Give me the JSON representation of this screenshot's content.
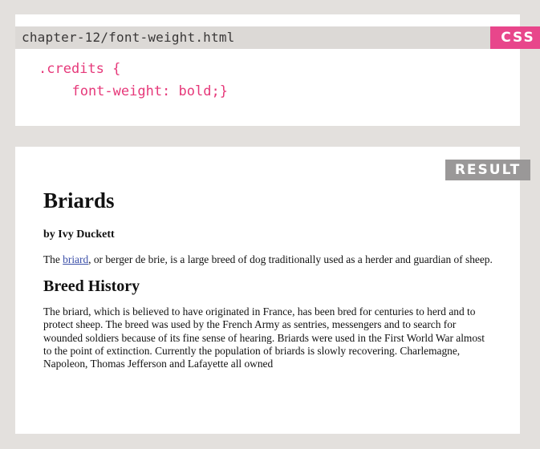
{
  "code_panel": {
    "file_name": "chapter-12/font-weight.html",
    "badge": "CSS",
    "lines": [
      ".credits {",
      "  font-weight: bold;}"
    ]
  },
  "result_panel": {
    "badge": "RESULT",
    "heading": "Briards",
    "credits": "by Ivy Duckett",
    "intro_before_link": "The ",
    "intro_link": "briard",
    "intro_after_link": ", or berger de brie, is a large breed of dog traditionally used as a herder and guardian of sheep.",
    "subheading": "Breed History",
    "history_text": "The briard, which is believed to have originated in France, has been bred for centuries to herd and to protect sheep. The breed was used by the French Army as sentries, messengers and to search for wounded soldiers because of its fine sense of hearing. Briards were used in the First World War almost to the point of extinction. Currently the population of briards is slowly recovering. Charlemagne, Napoleon, Thomas Jefferson and Lafayette all owned"
  },
  "colors": {
    "background": "#e3e0dd",
    "css_accent": "#e8468b",
    "code_text": "#e6397a",
    "result_badge": "#9a9898",
    "link": "#3b4fa8"
  }
}
